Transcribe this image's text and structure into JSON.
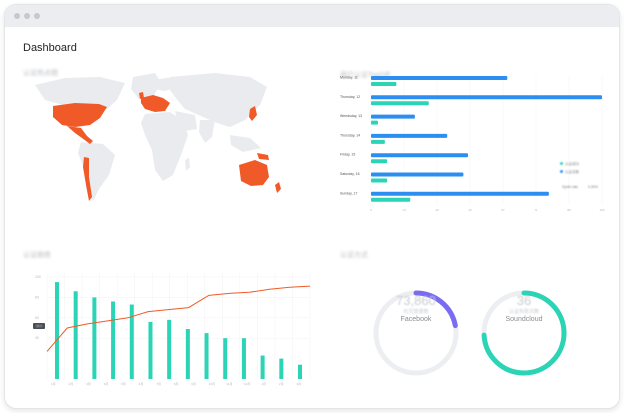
{
  "window": {
    "title": "Dashboard"
  },
  "colors": {
    "accent_orange": "#f05a28",
    "teal": "#2ad4b5",
    "blue": "#2b8ef0",
    "purple": "#7a6cf0",
    "map_land": "#e9ebef"
  },
  "sections": {
    "map_title": "认证热点图",
    "bars_title": "用户认证TopDiff",
    "combo_title": "认证趋势",
    "donut_title": "认证方式"
  },
  "map": {
    "highlighted_regions": [
      "United States",
      "Mexico",
      "Central America",
      "Western Europe",
      "Japan",
      "Australia",
      "New Zealand",
      "Peru",
      "Chile"
    ]
  },
  "bar_chart": {
    "chart_data": {
      "type": "bar",
      "orientation": "horizontal",
      "categories": [
        "Monday, 11",
        "Thursday, 12",
        "Wendsday, 13",
        "Thursday, 14",
        "Friday, 15",
        "Saturday, 16",
        "Sunday, 17"
      ],
      "series": [
        {
          "name": "认证总数",
          "color": "#2b8ef0",
          "values": [
            59,
            100,
            19,
            33,
            42,
            40,
            77
          ]
        },
        {
          "name": "认证成功",
          "color": "#2ad4b5",
          "values": [
            11,
            25,
            3,
            6,
            7,
            7,
            17
          ]
        }
      ],
      "xlim": [
        0,
        100
      ],
      "legend": "right"
    },
    "extra_label_left": "Synth rate",
    "extra_label_right": "0.30%"
  },
  "combo_chart": {
    "chart_data": {
      "type": "bar",
      "categories": [
        "1月",
        "2月",
        "3月",
        "4月",
        "5月",
        "6月",
        "7月",
        "8月",
        "9月",
        "10月",
        "11月",
        "12月",
        "1月",
        "2月",
        "3月"
      ],
      "series": [
        {
          "name": "bars",
          "color": "#2ad4b5",
          "values": [
            95,
            86,
            80,
            76,
            73,
            56,
            58,
            49,
            45,
            40,
            40,
            23,
            20,
            14
          ]
        },
        {
          "name": "line",
          "color": "#f05a28",
          "values": [
            27,
            50,
            54,
            57,
            60,
            66,
            68,
            70,
            82,
            84,
            85,
            88,
            90,
            91
          ]
        }
      ],
      "ylim": [
        0,
        100
      ],
      "ytick_labels": [
        "100",
        "80",
        "60",
        "40"
      ],
      "grid": true
    },
    "badge": "25.4"
  },
  "donuts": [
    {
      "value": "73,860",
      "sublabel": "社交登录数",
      "label": "Facebook",
      "color": "#7a6cf0",
      "fraction": 0.22
    },
    {
      "value": "36",
      "sublabel": "认证失败次数",
      "label": "Soundcloud",
      "color": "#2ad4b5",
      "fraction": 0.74
    }
  ]
}
